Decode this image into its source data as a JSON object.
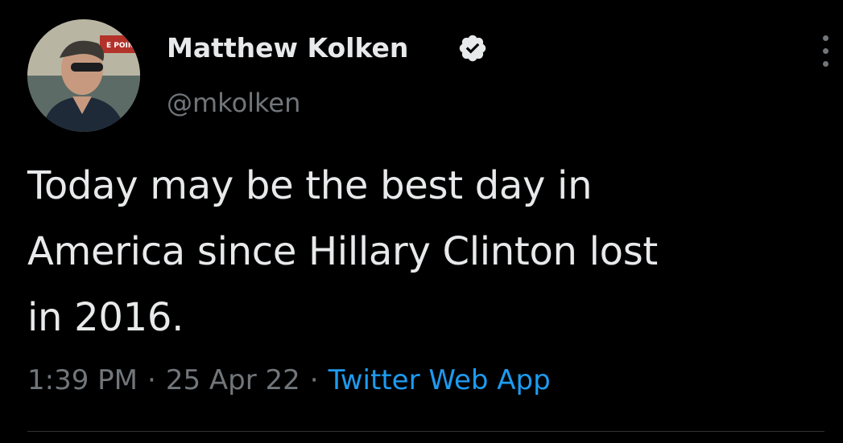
{
  "author": {
    "display_name": "Matthew Kolken",
    "handle": "@mkolken",
    "verified": true,
    "avatar_icon": "profile-photo-avatar",
    "avatar_sign_text": "E POINT"
  },
  "tweet": {
    "text": "Today may be the best day in\nAmerica since Hillary Clinton lost\nin 2016."
  },
  "meta": {
    "time": "1:39 PM",
    "date": "25 Apr 22",
    "separator": "·",
    "source": "Twitter Web App"
  },
  "colors": {
    "background": "#000000",
    "primary_text": "#e7e9ea",
    "secondary_text": "#71767b",
    "link": "#1d9bf0",
    "verified_badge": "#e7e9ea"
  },
  "icons": {
    "verified": "verified-badge-icon",
    "more": "more-vertical-icon"
  }
}
